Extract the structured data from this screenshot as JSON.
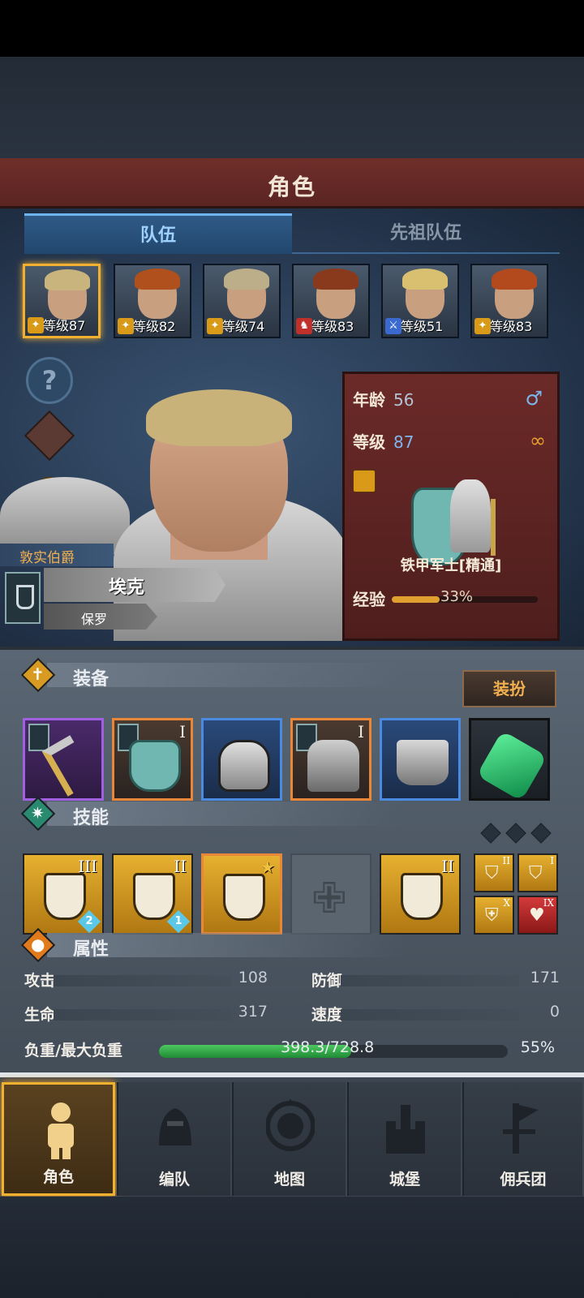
{
  "header": {
    "title": "角色"
  },
  "tabs": [
    {
      "label": "队伍",
      "active": true
    },
    {
      "label": "先祖队伍",
      "active": false
    }
  ],
  "roster": [
    {
      "level_text": "等级87",
      "class_icon": "crusader-icon",
      "selected": true,
      "hair": "#c8b47c"
    },
    {
      "level_text": "等级82",
      "class_icon": "crusader-icon",
      "selected": false,
      "hair": "#b0501c"
    },
    {
      "level_text": "等级74",
      "class_icon": "crusader-icon",
      "selected": false,
      "hair": "#bcae88"
    },
    {
      "level_text": "等级83",
      "class_icon": "beast-icon",
      "selected": false,
      "hair": "#8a3a1c"
    },
    {
      "level_text": "等级51",
      "class_icon": "sword-icon",
      "selected": false,
      "hair": "#d8c070"
    },
    {
      "level_text": "等级83",
      "class_icon": "crusader-icon",
      "selected": false,
      "hair": "#b24a1e"
    }
  ],
  "character": {
    "title": "敦实伯爵",
    "name": "埃克",
    "surname": "保罗"
  },
  "info": {
    "age_label": "年龄",
    "age_value": "56",
    "level_label": "等级",
    "level_value": "87",
    "class_name": "铁甲军士[精通]",
    "exp_label": "经验",
    "exp_value": "33%",
    "exp_fraction": 0.33
  },
  "equipment": {
    "section_label": "装备",
    "dress_button": "装扮",
    "slots": [
      {
        "name": "weapon-pickaxe",
        "rarity": "purple",
        "roman": ""
      },
      {
        "name": "shield",
        "rarity": "orange",
        "roman": "I"
      },
      {
        "name": "helmet",
        "rarity": "blue",
        "roman": ""
      },
      {
        "name": "armor",
        "rarity": "orange",
        "roman": "I"
      },
      {
        "name": "boots",
        "rarity": "blue",
        "roman": ""
      },
      {
        "name": "gem",
        "rarity": "dark",
        "roman": ""
      }
    ]
  },
  "skills": {
    "section_label": "技能",
    "main": [
      {
        "roman": "III",
        "badge": "2",
        "border": "normal"
      },
      {
        "roman": "II",
        "badge": "1",
        "border": "normal"
      },
      {
        "roman": "",
        "badge": "",
        "border": "orange"
      },
      {
        "roman": "",
        "badge": "",
        "border": "empty"
      },
      {
        "roman": "II",
        "badge": "",
        "border": "normal"
      }
    ],
    "mini": [
      {
        "roman": "II",
        "color": "gold"
      },
      {
        "roman": "I",
        "color": "gold"
      },
      {
        "roman": "X",
        "color": "gold"
      },
      {
        "roman": "IX",
        "color": "red"
      }
    ]
  },
  "attributes": {
    "section_label": "属性",
    "attack_label": "攻击",
    "attack_value": "108",
    "defense_label": "防御",
    "defense_value": "171",
    "hp_label": "生命",
    "hp_value": "317",
    "speed_label": "速度",
    "speed_value": "0",
    "weight_label": "负重/最大负重",
    "weight_value": "398.3/728.8",
    "weight_percent": "55%",
    "weight_fraction": 0.55
  },
  "nav": [
    {
      "label": "角色",
      "active": true
    },
    {
      "label": "编队",
      "active": false
    },
    {
      "label": "地图",
      "active": false
    },
    {
      "label": "城堡",
      "active": false
    },
    {
      "label": "佣兵团",
      "active": false
    }
  ]
}
